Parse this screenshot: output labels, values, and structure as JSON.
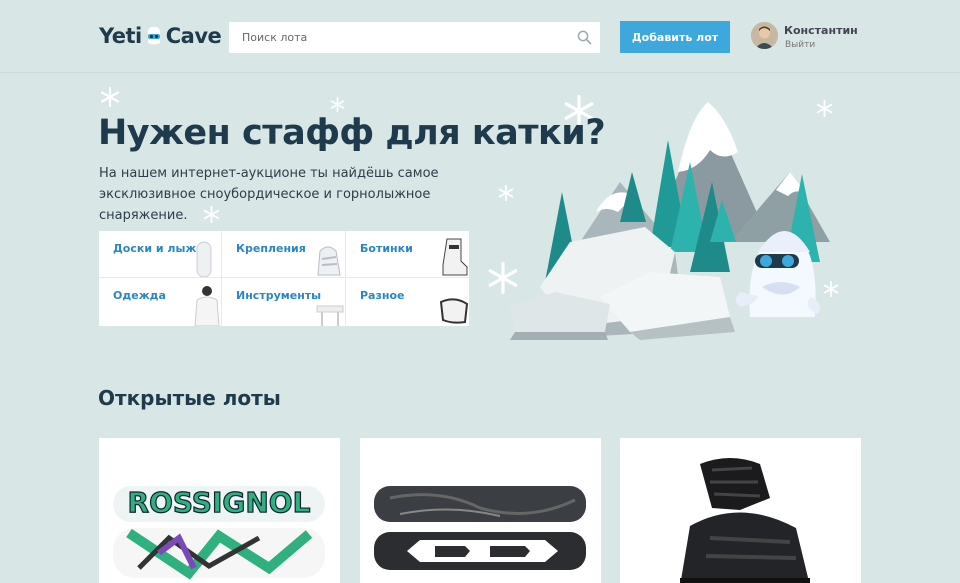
{
  "header": {
    "logo_left": "Yeti",
    "logo_right": "Cave",
    "search_placeholder": "Поиск лота",
    "add_button": "Добавить лот",
    "user_name": "Константин",
    "logout": "Выйти"
  },
  "promo": {
    "title": "Нужен стафф для катки?",
    "text": "На нашем интернет-аукционе ты найдёшь самое эксклюзивное сноубордическое и горнолыжное снаряжение."
  },
  "categories": [
    {
      "label": "Доски и лыжи"
    },
    {
      "label": "Крепления"
    },
    {
      "label": "Ботинки"
    },
    {
      "label": "Одежда"
    },
    {
      "label": "Инструменты"
    },
    {
      "label": "Разное"
    }
  ],
  "lots": {
    "title": "Открытые лоты",
    "board_text": "ROSSIGNOL"
  },
  "colors": {
    "accent": "#3ea7dc",
    "background": "#d8e6e6",
    "title": "#1e3a4c",
    "link": "#2a86c4"
  }
}
